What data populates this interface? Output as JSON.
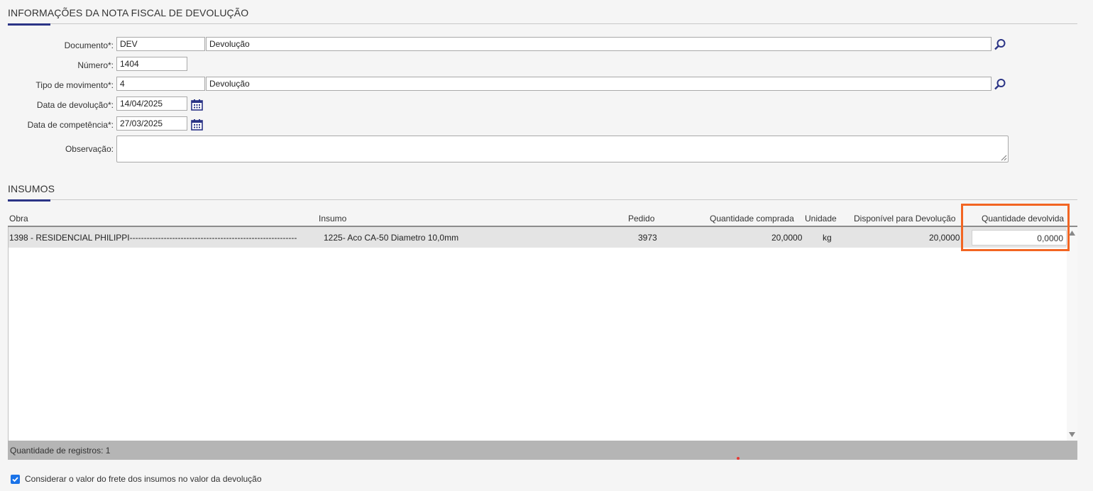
{
  "section_info": {
    "title": "INFORMAÇÕES DA NOTA FISCAL DE DEVOLUÇÃO"
  },
  "form": {
    "documento": {
      "label": "Documento*:",
      "code": "DEV",
      "description": "Devolução"
    },
    "numero": {
      "label": "Número*:",
      "value": "1404"
    },
    "tipo_movimento": {
      "label": "Tipo de movimento*:",
      "code": "4",
      "description": "Devolução"
    },
    "data_devolucao": {
      "label": "Data de devolução*:",
      "value": "14/04/2025"
    },
    "data_competencia": {
      "label": "Data de competência*:",
      "value": "27/03/2025"
    },
    "observacao": {
      "label": "Observação:",
      "value": ""
    }
  },
  "section_insumos": {
    "title": "INSUMOS"
  },
  "grid": {
    "columns": [
      "Obra",
      "Insumo",
      "Pedido",
      "Quantidade comprada",
      "Unidade",
      "Disponível para Devolução",
      "Quantidade devolvida"
    ],
    "rows": [
      {
        "obra": "1398 - RESIDENCIAL PHILIPPI-----------------------------------------------------------",
        "insumo": "1225- Aco CA-50 Diametro 10,0mm",
        "pedido": "3973",
        "quantidade_comprada": "20,0000",
        "unidade": "kg",
        "disponivel": "20,0000",
        "quantidade_devolvida": "0,0000"
      }
    ],
    "footer": "Quantidade de registros: 1"
  },
  "checkbox_frete": {
    "label": "Considerar o valor do frete dos insumos no valor da devolução",
    "checked": true
  },
  "colors": {
    "accent": "#2b3486",
    "highlight": "#f26522",
    "checkbox": "#1a73e8"
  },
  "icons": {
    "search": "search-icon",
    "calendar": "calendar-icon"
  }
}
